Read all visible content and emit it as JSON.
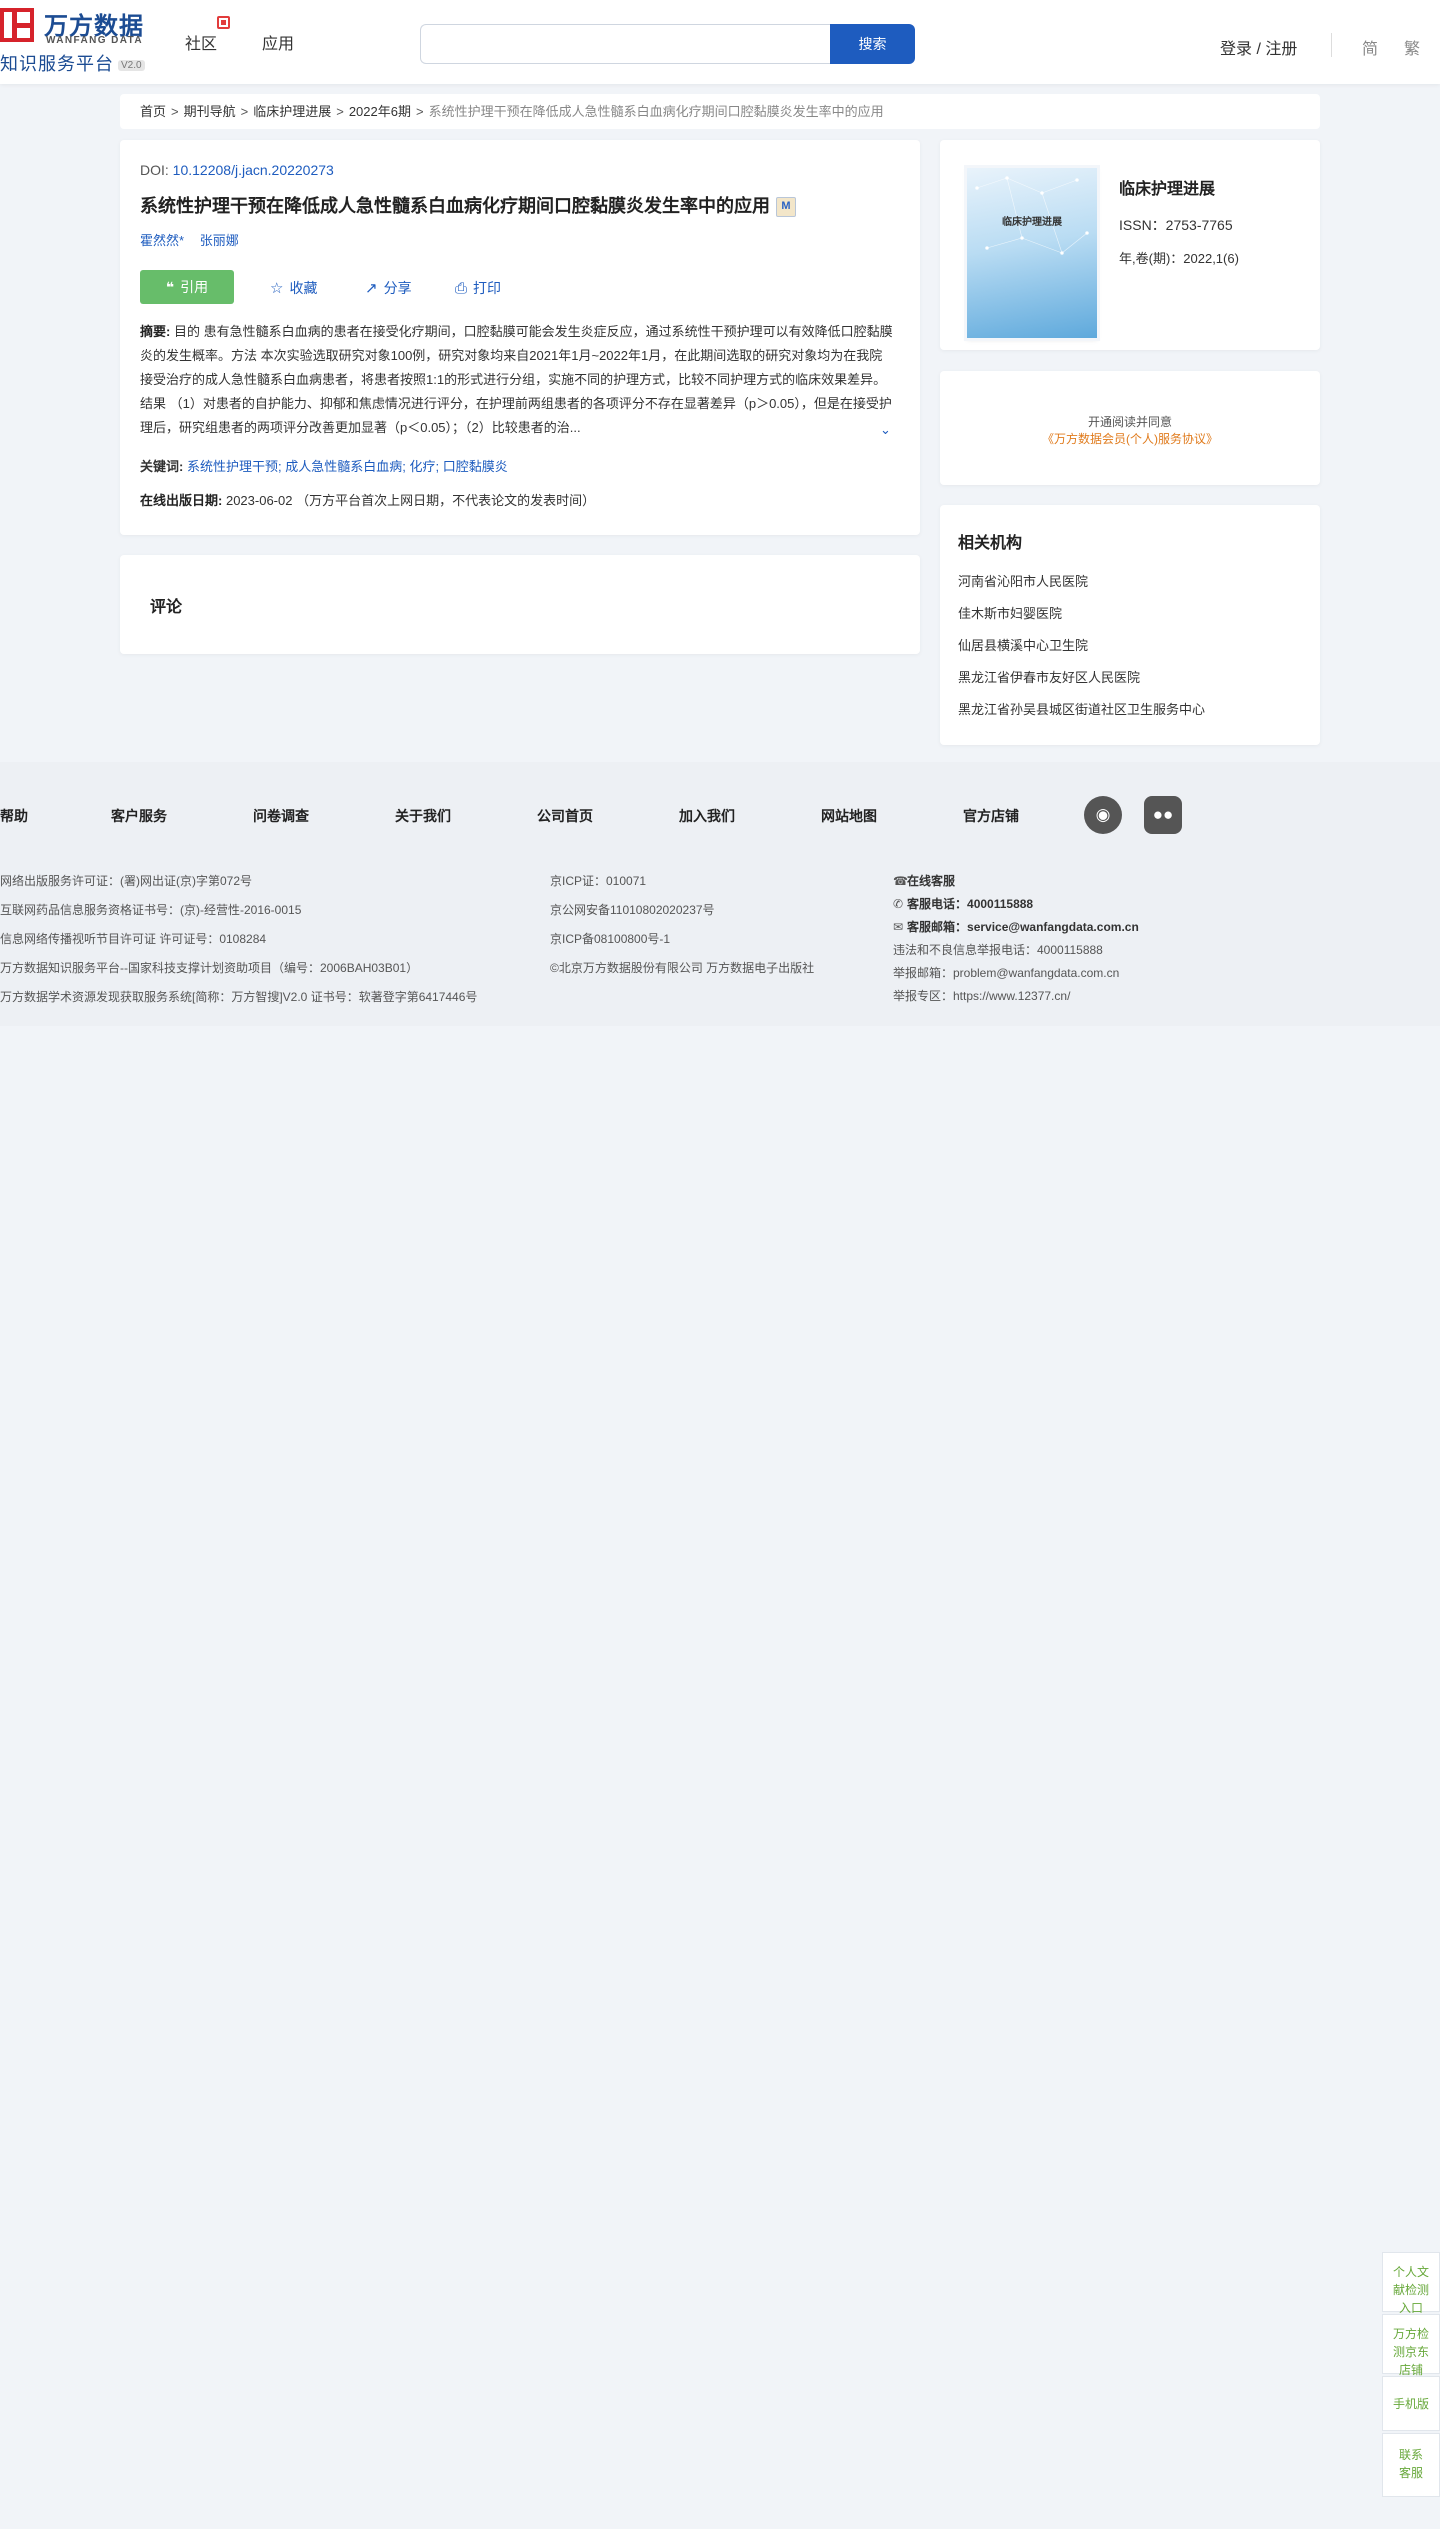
{
  "header": {
    "logo_cn": "万方数据",
    "logo_en": "WANFANG DATA",
    "logo_sub": "知识服务平台",
    "logo_ver": "V2.0",
    "nav": [
      "社区",
      "应用"
    ],
    "search_placeholder": "",
    "search_button": "搜索",
    "login": "登录 / 注册",
    "lang_simplified": "简",
    "lang_traditional": "繁"
  },
  "breadcrumb": {
    "items": [
      "首页",
      "期刊导航",
      "临床护理进展",
      "2022年6期"
    ],
    "current": "系统性护理干预在降低成人急性髓系白血病化疗期间口腔黏膜炎发生率中的应用",
    "separator": ">"
  },
  "article": {
    "doi_label": "DOI:",
    "doi": "10.12208/j.jacn.20220273",
    "title": "系统性护理干预在降低成人急性髓系白血病化疗期间口腔黏膜炎发生率中的应用",
    "m_badge": "M",
    "authors": [
      "霍然然*",
      "张丽娜"
    ],
    "actions": {
      "cite": "引用",
      "favorite": "收藏",
      "share": "分享",
      "print": "打印"
    },
    "abstract_label": "摘要:",
    "abstract": "目的 患有急性髓系白血病的患者在接受化疗期间，口腔黏膜可能会发生炎症反应，通过系统性干预护理可以有效降低口腔黏膜炎的发生概率。方法 本次实验选取研究对象100例，研究对象均来自2021年1月~2022年1月，在此期间选取的研究对象均为在我院接受治疗的成人急性髓系白血病患者，将患者按照1:1的形式进行分组，实施不同的护理方式，比较不同护理方式的临床效果差异。结果 （1）对患者的自护能力、抑郁和焦虑情况进行评分，在护理前两组患者的各项评分不存在显著差异（p＞0.05），但是在接受护理后，研究组患者的两项评分改善更加显著（p＜0.05）；（2）比较患者的治...",
    "keywords_label": "关键词:",
    "keywords": [
      "系统性护理干预;",
      "成人急性髓系白血病;",
      "化疗;",
      "口腔黏膜炎"
    ],
    "pubdate_label": "在线出版日期:",
    "pubdate": "2023-06-02",
    "pubdate_note": "（万方平台首次上网日期，不代表论文的发表时间）"
  },
  "comments": {
    "title": "评论"
  },
  "journal": {
    "cover_title": "临床护理进展",
    "name": "临床护理进展",
    "issn": "ISSN：2753-7765",
    "volume": "年,卷(期)：2022,1(6)"
  },
  "agreement": {
    "line1": "开通阅读并同意",
    "line2": "《万方数据会员(个人)服务协议》"
  },
  "orgs": {
    "title": "相关机构",
    "items": [
      "河南省沁阳市人民医院",
      "佳木斯市妇婴医院",
      "仙居县横溪中心卫生院",
      "黑龙江省伊春市友好区人民医院",
      "黑龙江省孙吴县城区街道社区卫生服务中心"
    ]
  },
  "footer": {
    "links": [
      "帮助",
      "客户服务",
      "问卷调查",
      "关于我们",
      "公司首页",
      "加入我们",
      "网站地图",
      "官方店铺"
    ],
    "col1": [
      "网络出版服务许可证：(署)网出证(京)字第072号",
      "互联网药品信息服务资格证书号：(京)-经营性-2016-0015",
      "信息网络传播视听节目许可证 许可证号：0108284",
      "万方数据知识服务平台--国家科技支撑计划资助项目（编号：2006BAH03B01）",
      "万方数据学术资源发现获取服务系统[简称：万方智搜]V2.0 证书号：软著登字第6417446号"
    ],
    "col2": [
      "京ICP证：010071",
      "京公网安备11010802020237号",
      "京ICP备08100800号-1",
      "©北京万方数据股份有限公司 万方数据电子出版社"
    ],
    "online_service": "在线客服",
    "phone_label": "客服电话：",
    "phone": "4000115888",
    "email_label": "客服邮箱：",
    "email": "service@wanfangdata.com.cn",
    "report_phone": "违法和不良信息举报电话：4000115888",
    "report_email": "举报邮箱：problem@wanfangdata.com.cn",
    "report_zone": "举报专区：https://www.12377.cn/"
  },
  "float": {
    "personal_check": "个人文献检测入口",
    "jd_store": "万方检测京东店铺",
    "mobile": "手机版",
    "contact": "联系客服"
  },
  "colors": {
    "brand_blue": "#1e5cbf",
    "logo_red": "#d6232b",
    "cite_green": "#67bd6a",
    "agreement_orange": "#e07b1d"
  }
}
